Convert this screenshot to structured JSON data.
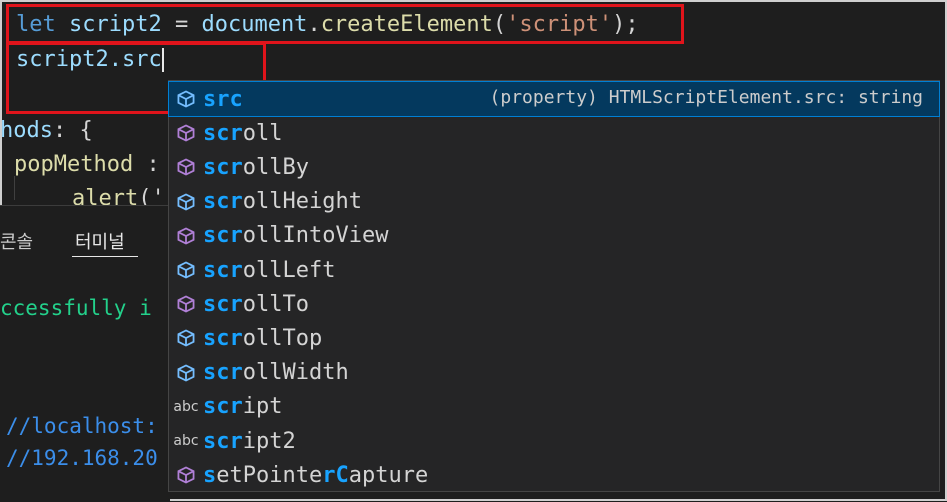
{
  "editor": {
    "line1": {
      "kw": "let",
      "var": "script2",
      "eq": "=",
      "obj": "document",
      "fn": "createElement",
      "open": "(",
      "str": "'script'",
      "close": ");"
    },
    "line2": {
      "text": "script2.src"
    },
    "line3": {
      "prop": "hods",
      "rest": ": {"
    },
    "line4": {
      "prop": "popMethod",
      "rest": " :"
    },
    "line5": {
      "fn": "alert",
      "rest": "('"
    }
  },
  "panel": {
    "tab_console": "콘솔",
    "tab_terminal": "터미널",
    "term1": "ccessfully i",
    "term2": "//localhost:",
    "term3": "//192.168.20"
  },
  "suggest": {
    "detail": "(property) HTMLScriptElement.src: string",
    "items": [
      {
        "match": "src",
        "rest": "",
        "kind": "property",
        "selected": true
      },
      {
        "match": "scr",
        "rest": "oll",
        "kind": "method"
      },
      {
        "match": "scr",
        "rest": "ollBy",
        "kind": "method"
      },
      {
        "match": "scr",
        "rest": "ollHeight",
        "kind": "property"
      },
      {
        "match": "scr",
        "rest": "ollIntoView",
        "kind": "method"
      },
      {
        "match": "scr",
        "rest": "ollLeft",
        "kind": "property"
      },
      {
        "match": "scr",
        "rest": "ollTo",
        "kind": "method"
      },
      {
        "match": "scr",
        "rest": "ollTop",
        "kind": "property"
      },
      {
        "match": "scr",
        "rest": "ollWidth",
        "kind": "property"
      },
      {
        "match": "scr",
        "rest": "ipt",
        "kind": "text",
        "kind_label": "abc"
      },
      {
        "match": "scr",
        "rest": "ipt2",
        "kind": "text",
        "kind_label": "abc"
      },
      {
        "pre1": "",
        "m1": "s",
        "pre2": "etPointe",
        "m2": "rC",
        "rest": "apture",
        "kind": "method",
        "split": true
      }
    ]
  },
  "colors": {
    "highlight_box": "#e0141b",
    "selection_bg": "#04395e",
    "match": "#18a3ff",
    "property_icon": "#75beff",
    "method_icon": "#b180d7"
  }
}
